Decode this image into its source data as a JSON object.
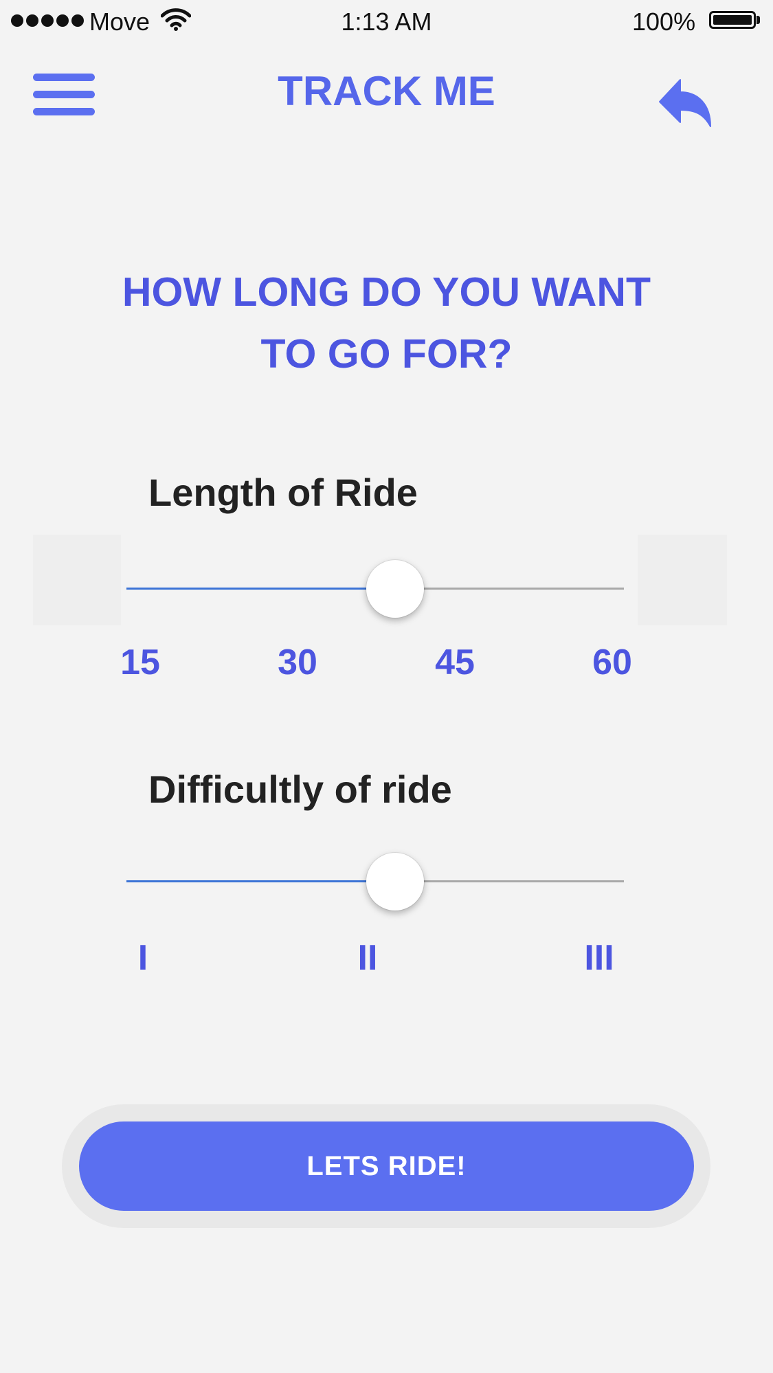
{
  "status_bar": {
    "carrier": "Move",
    "time": "1:13 AM",
    "battery_percent": "100%",
    "icons": [
      "signal-dots-icon",
      "wifi-icon",
      "battery-icon"
    ]
  },
  "header": {
    "title": "TRACK ME",
    "menu_icon": "hamburger-menu-icon",
    "back_icon": "reply-arrow-icon"
  },
  "question": {
    "line1": "HOW LONG DO YOU WANT",
    "line2": "TO GO FOR?"
  },
  "length_slider": {
    "label": "Length of Ride",
    "ticks": [
      "15",
      "30",
      "45",
      "60"
    ],
    "value_fraction": 0.54
  },
  "difficulty_slider": {
    "label": "Difficultly of ride",
    "ticks": [
      "I",
      "II",
      "III"
    ],
    "value_fraction": 0.54
  },
  "cta": {
    "label": "LETS RIDE!"
  },
  "colors": {
    "accent": "#5b6ff0",
    "heading": "#4c55e0",
    "background": "#f3f3f3",
    "slider_fill": "#3b73d6"
  }
}
